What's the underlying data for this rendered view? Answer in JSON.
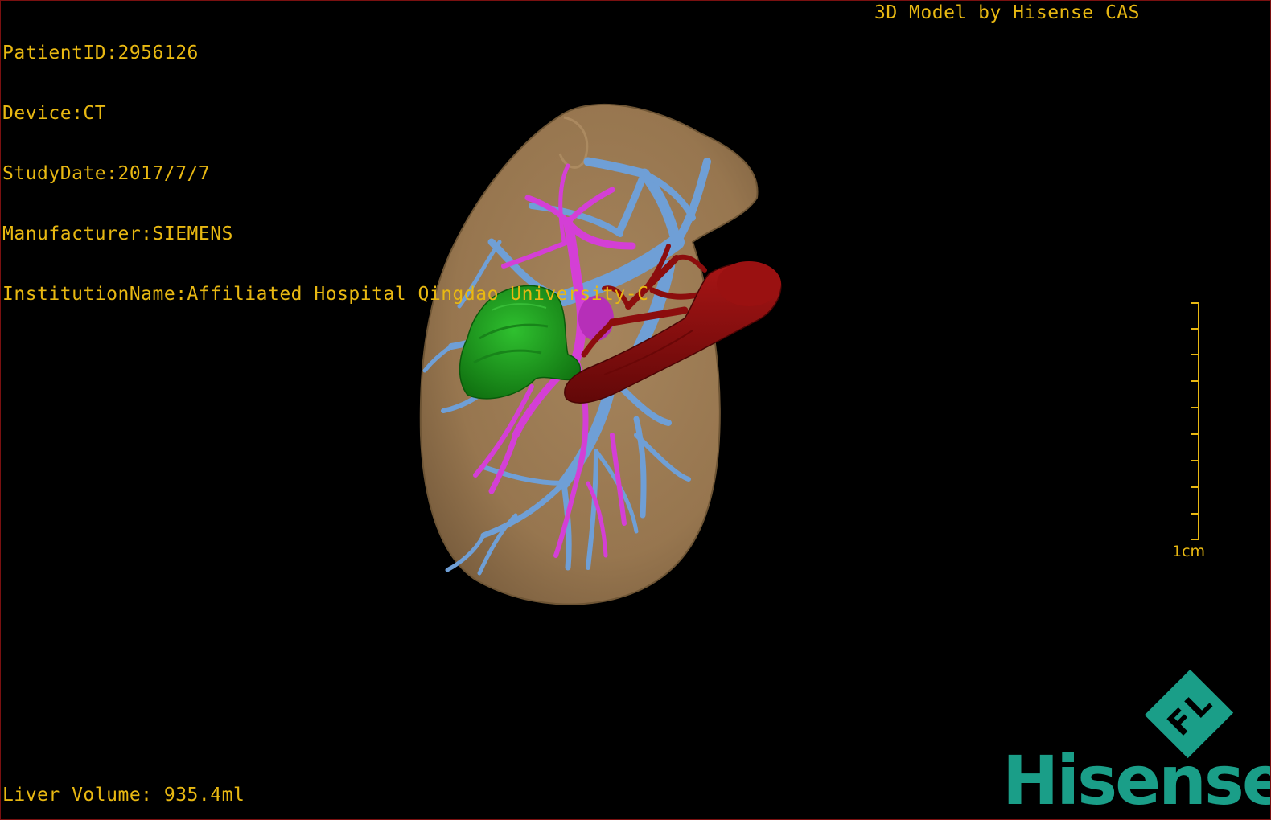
{
  "patient_info": {
    "patient_id": "PatientID:2956126",
    "device": "Device:CT",
    "study_date": "StudyDate:2017/7/7",
    "manufacturer": "Manufacturer:SIEMENS",
    "institution": "InstitutionName:Affiliated Hospital Qingdao University-C"
  },
  "model_credit": "3D Model by Hisense CAS",
  "liver_volume": "Liver Volume: 935.4ml",
  "scale_label": "1cm",
  "logo": {
    "text": "Hisense",
    "mark_letters": [
      "F",
      "L"
    ],
    "color": "#1a9e88"
  },
  "colors": {
    "overlay_text": "#e8b812",
    "liver": "#9c7a52",
    "portal_vein": "#6f9fd6",
    "hepatic_vein": "#d43fd6",
    "artery_ivc": "#8c0d0d",
    "gallbladder": "#1e9a1e"
  },
  "icons": [
    "hisense-fl-logo-icon",
    "scale-bar-icon"
  ]
}
